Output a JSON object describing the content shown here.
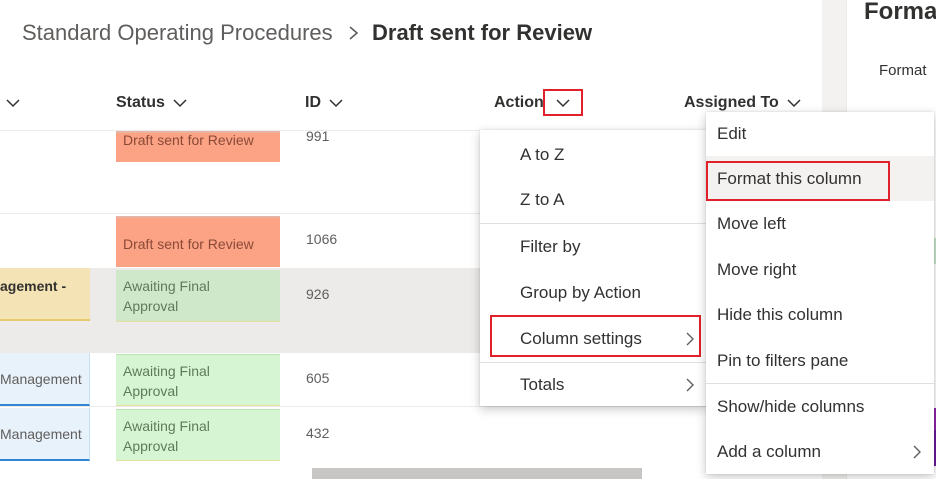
{
  "breadcrumb": {
    "root": "Standard Operating Procedures",
    "current": "Draft sent for Review"
  },
  "columns": {
    "status": "Status",
    "id": "ID",
    "action": "Action",
    "assigned": "Assigned To"
  },
  "side_panel": {
    "title": "Forma",
    "subtitle": "Format"
  },
  "rows": [
    {
      "left": "",
      "status": "Draft sent for Review",
      "status_lines": [
        "Draft sent for Review"
      ],
      "id": "991"
    },
    {
      "left": "",
      "status": "Draft sent for Review",
      "status_lines": [
        "Draft sent for Review"
      ],
      "id": "1066"
    },
    {
      "left": "agement -",
      "status": "Awaiting Final Approval",
      "status_lines": [
        "Awaiting Final",
        "Approval"
      ],
      "id": "926"
    },
    {
      "left": "Management",
      "status": "Awaiting Final Approval",
      "status_lines": [
        "Awaiting Final",
        "Approval"
      ],
      "id": "605"
    },
    {
      "left": "Management",
      "status": "Awaiting Final Approval",
      "status_lines": [
        "Awaiting Final",
        "Approval"
      ],
      "id": "432"
    }
  ],
  "sort_menu": {
    "items": [
      {
        "label": "A to Z"
      },
      {
        "label": "Z to A"
      },
      {
        "label": "Filter by"
      },
      {
        "label": "Group by Action"
      },
      {
        "label": "Column settings"
      },
      {
        "label": "Totals"
      }
    ]
  },
  "column_settings_menu": {
    "items": [
      {
        "label": "Edit"
      },
      {
        "label": "Format this column"
      },
      {
        "label": "Move left"
      },
      {
        "label": "Move right"
      },
      {
        "label": "Hide this column"
      },
      {
        "label": "Pin to filters pane"
      },
      {
        "label": "Show/hide columns"
      },
      {
        "label": "Add a column"
      }
    ]
  },
  "icons": {
    "breadcrumb_separator": "chevron-right-icon",
    "column_dropdown": "chevron-down-icon",
    "submenu": "chevron-right-icon"
  },
  "colors": {
    "highlight_box": "#e0202a",
    "status_draft": "#fca385",
    "status_final": "#d6f5d2",
    "menu_hover": "#f3f2f1"
  }
}
